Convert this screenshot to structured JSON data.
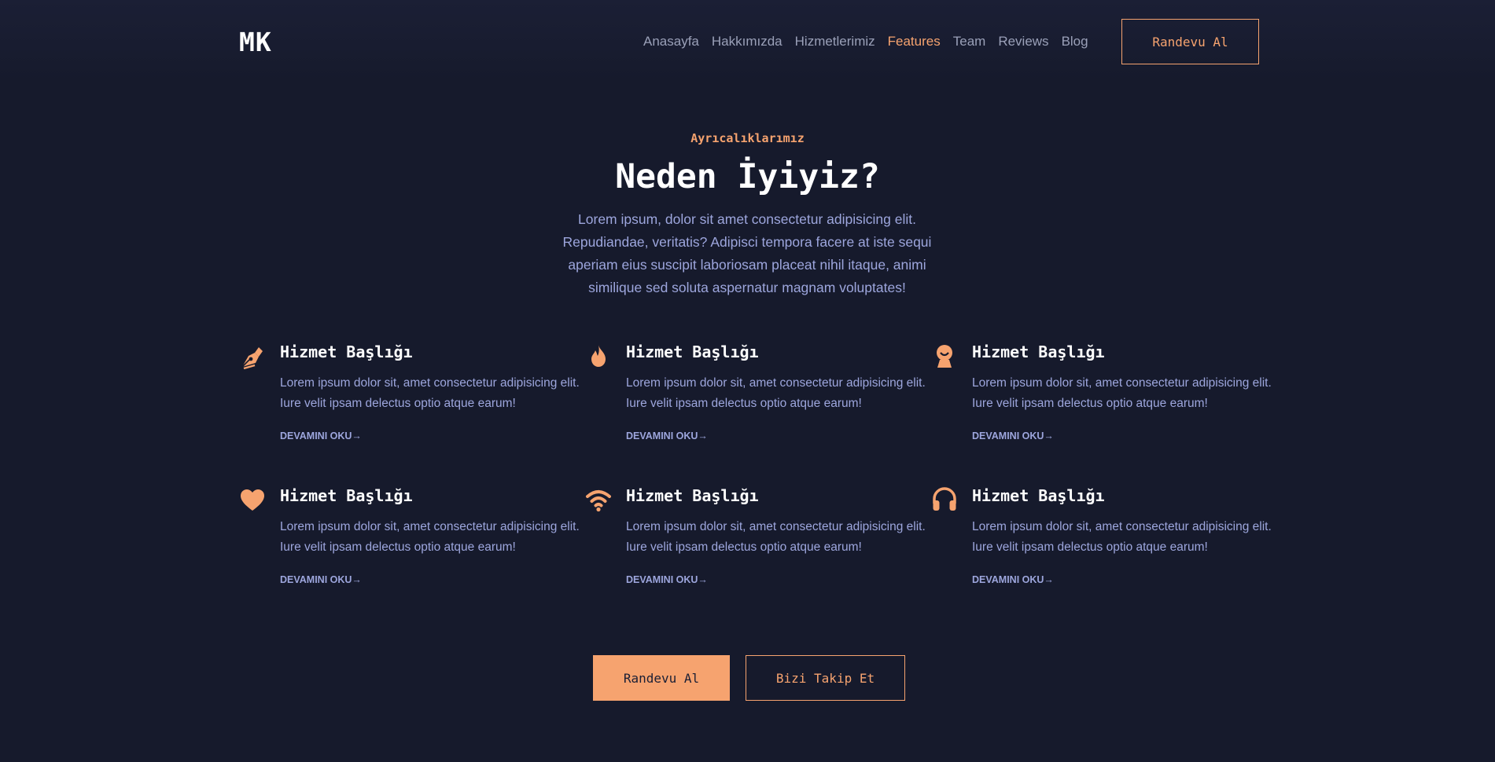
{
  "header": {
    "logo": "MK",
    "nav": [
      "Anasayfa",
      "Hakkımızda",
      "Hizmetlerimiz",
      "Features",
      "Team",
      "Reviews",
      "Blog"
    ],
    "active_nav": "Features",
    "cta_label": "Randevu Al"
  },
  "section": {
    "eyebrow": "Ayrıcalıklarımız",
    "title": "Neden İyiyiz?",
    "lead": "Lorem ipsum, dolor sit amet consectetur adipisicing elit. Repudiandae, veritatis? Adipisci tempora facere at iste sequi aperiam eius suscipit laboriosam placeat nihil itaque, animi similique sed soluta aspernatur magnam voluptates!"
  },
  "features": [
    {
      "icon": "pen-nib-icon",
      "title": "Hizmet Başlığı",
      "text": "Lorem ipsum dolor sit, amet consectetur adipisicing elit. Iure velit ipsam delectus optio atque earum!",
      "link": "DEVAMINI OKU→"
    },
    {
      "icon": "fire-icon",
      "title": "Hizmet Başlığı",
      "text": "Lorem ipsum dolor sit, amet consectetur adipisicing elit. Iure velit ipsam delectus optio atque earum!",
      "link": "DEVAMINI OKU→"
    },
    {
      "icon": "user-support-icon",
      "title": "Hizmet Başlığı",
      "text": "Lorem ipsum dolor sit, amet consectetur adipisicing elit. Iure velit ipsam delectus optio atque earum!",
      "link": "DEVAMINI OKU→"
    },
    {
      "icon": "heart-icon",
      "title": "Hizmet Başlığı",
      "text": "Lorem ipsum dolor sit, amet consectetur adipisicing elit. Iure velit ipsam delectus optio atque earum!",
      "link": "DEVAMINI OKU→"
    },
    {
      "icon": "wifi-icon",
      "title": "Hizmet Başlığı",
      "text": "Lorem ipsum dolor sit, amet consectetur adipisicing elit. Iure velit ipsam delectus optio atque earum!",
      "link": "DEVAMINI OKU→"
    },
    {
      "icon": "headphones-icon",
      "title": "Hizmet Başlığı",
      "text": "Lorem ipsum dolor sit, amet consectetur adipisicing elit. Iure velit ipsam delectus optio atque earum!",
      "link": "DEVAMINI OKU→"
    }
  ],
  "cta": {
    "primary": "Randevu Al",
    "secondary": "Bizi Takip Et"
  },
  "colors": {
    "accent": "#f6a36f",
    "background": "#161a2c",
    "muted_text": "#9da6dd"
  }
}
